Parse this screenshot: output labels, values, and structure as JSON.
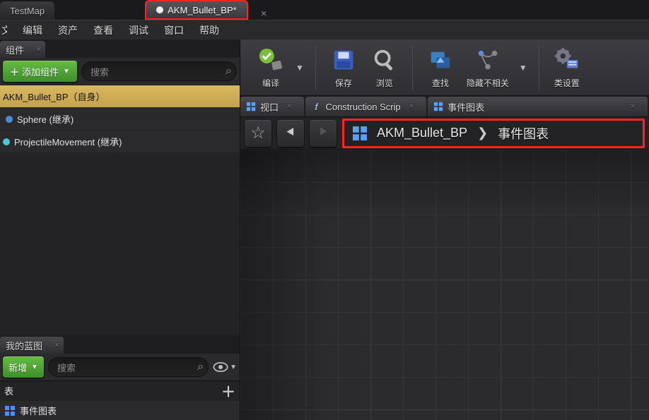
{
  "tabs": {
    "map": "TestMap",
    "bp": "AKM_Bullet_BP*"
  },
  "menu": {
    "file_half": "牛",
    "edit": "编辑",
    "asset": "资产",
    "view": "查看",
    "debug": "调试",
    "window": "窗口",
    "help": "帮助"
  },
  "components_panel": {
    "title": "组件",
    "add_btn": "添加组件",
    "search_placeholder": "搜索",
    "tree": {
      "root": "AKM_Bullet_BP（自身）",
      "sphere": "Sphere (继承)",
      "projmove": "ProjectileMovement (继承)"
    }
  },
  "mybp_panel": {
    "title": "我的蓝图",
    "add_btn": "新增",
    "search_placeholder": "搜索",
    "graph_heading_half": "表",
    "event_graph": "事件图表"
  },
  "toolbar": {
    "compile": "编译",
    "save": "保存",
    "browse": "浏览",
    "find": "查找",
    "hide_unrelated": "隐藏不相关",
    "class_settings": "类设置"
  },
  "graph_tabs": {
    "viewport": "视口",
    "construction": "Construction Scrip",
    "event_graph": "事件图表"
  },
  "breadcrumb": {
    "root": "AKM_Bullet_BP",
    "leaf": "事件图表"
  }
}
